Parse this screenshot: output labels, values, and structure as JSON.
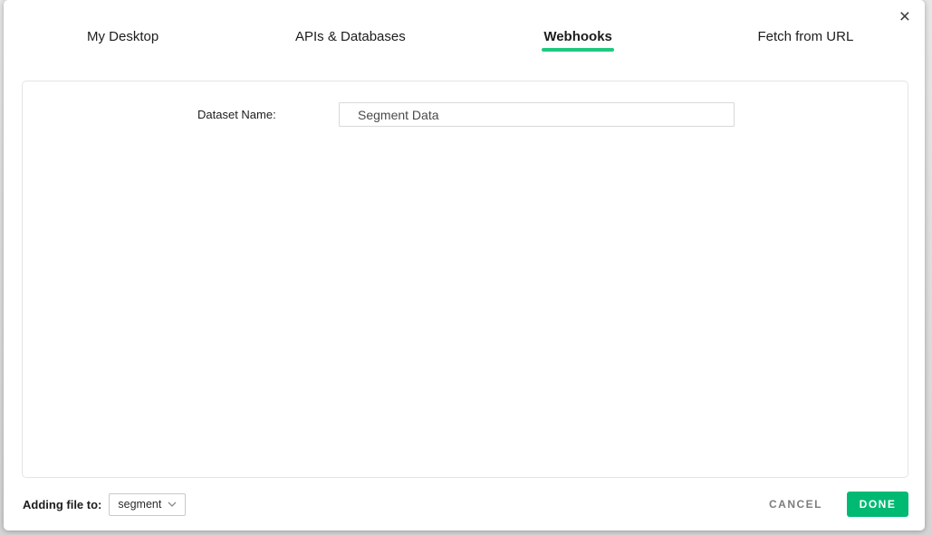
{
  "dialog": {
    "close_icon": "×",
    "tabs": [
      {
        "label": "My Desktop",
        "active": false
      },
      {
        "label": "APIs & Databases",
        "active": false
      },
      {
        "label": "Webhooks",
        "active": true
      },
      {
        "label": "Fetch from URL",
        "active": false
      }
    ],
    "form": {
      "dataset_name_label": "Dataset Name:",
      "dataset_name_value": "Segment Data"
    },
    "footer": {
      "adding_file_label": "Adding file to:",
      "folder_select_value": "segment",
      "cancel_label": "CANCEL",
      "done_label": "DONE"
    },
    "colors": {
      "accent_green": "#1ec97e",
      "done_green": "#00b973"
    }
  }
}
